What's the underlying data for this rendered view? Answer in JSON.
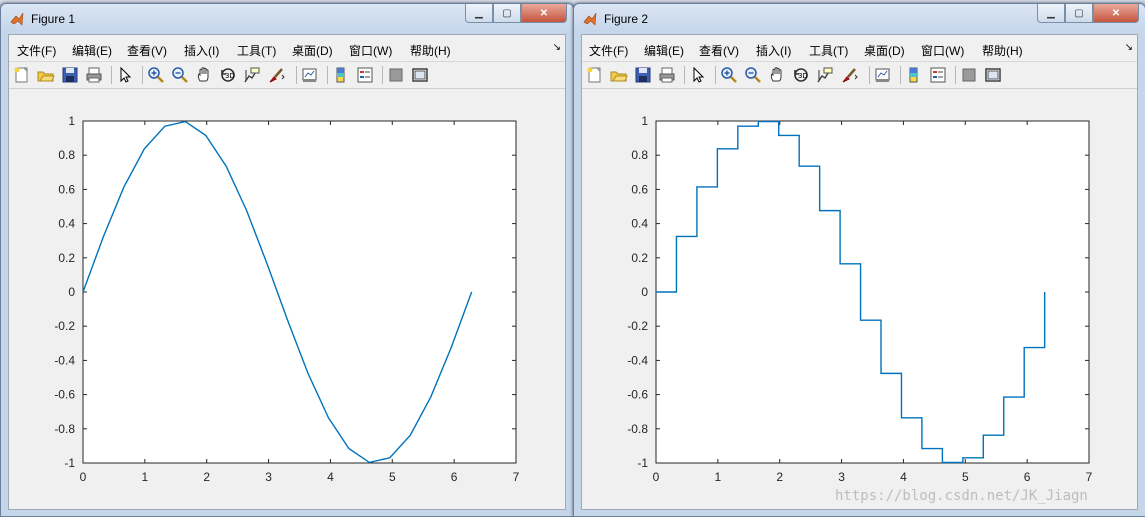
{
  "figures": [
    {
      "title": "Figure 1",
      "menu": [
        "文件(F)",
        "编辑(E)",
        "查看(V)",
        "插入(I)",
        "工具(T)",
        "桌面(D)",
        "窗口(W)",
        "帮助(H)"
      ],
      "chart_data": {
        "type": "line",
        "color": "#0072bd",
        "x": [
          0,
          0.3307,
          0.6614,
          0.9921,
          1.3228,
          1.6535,
          1.9842,
          2.3149,
          2.6456,
          2.9762,
          3.3069,
          3.6376,
          3.9683,
          4.299,
          4.6297,
          4.9604,
          5.2911,
          5.6218,
          5.9525,
          6.2832
        ],
        "y": [
          0,
          0.3247,
          0.6142,
          0.8372,
          0.9694,
          0.9966,
          0.9158,
          0.7357,
          0.4759,
          0.1646,
          -0.1646,
          -0.4759,
          -0.7357,
          -0.9158,
          -0.9966,
          -0.9694,
          -0.8372,
          -0.6142,
          -0.3247,
          0
        ],
        "xlim": [
          0,
          7
        ],
        "ylim": [
          -1,
          1
        ],
        "xticks": [
          "0",
          "1",
          "2",
          "3",
          "4",
          "5",
          "6",
          "7"
        ],
        "yticks": [
          "1",
          "0.8",
          "0.6",
          "0.4",
          "0.2",
          "0",
          "-0.2",
          "-0.4",
          "-0.6",
          "-0.8",
          "-1"
        ]
      }
    },
    {
      "title": "Figure 2",
      "menu": [
        "文件(F)",
        "编辑(E)",
        "查看(V)",
        "插入(I)",
        "工具(T)",
        "桌面(D)",
        "窗口(W)",
        "帮助(H)"
      ],
      "chart_data": {
        "type": "stairs",
        "color": "#0072bd",
        "x": [
          0,
          0.3307,
          0.6614,
          0.9921,
          1.3228,
          1.6535,
          1.9842,
          2.3149,
          2.6456,
          2.9762,
          3.3069,
          3.6376,
          3.9683,
          4.299,
          4.6297,
          4.9604,
          5.2911,
          5.6218,
          5.9525,
          6.2832
        ],
        "y": [
          0,
          0.3247,
          0.6142,
          0.8372,
          0.9694,
          0.9966,
          0.9158,
          0.7357,
          0.4759,
          0.1646,
          -0.1646,
          -0.4759,
          -0.7357,
          -0.9158,
          -0.9966,
          -0.9694,
          -0.8372,
          -0.6142,
          -0.3247,
          0
        ],
        "xlim": [
          0,
          7
        ],
        "ylim": [
          -1,
          1
        ],
        "xticks": [
          "0",
          "1",
          "2",
          "3",
          "4",
          "5",
          "6",
          "7"
        ],
        "yticks": [
          "1",
          "0.8",
          "0.6",
          "0.4",
          "0.2",
          "0",
          "-0.2",
          "-0.4",
          "-0.6",
          "-0.8",
          "-1"
        ]
      }
    }
  ],
  "toolbar_icons": [
    "new-figure-icon",
    "open-file-icon",
    "save-icon",
    "print-icon",
    "|",
    "pointer-icon",
    "|",
    "zoom-in-icon",
    "zoom-out-icon",
    "pan-icon",
    "rotate-3d-icon",
    "data-cursor-icon",
    "brush-icon",
    "|",
    "link-plot-icon",
    "|",
    "colorbar-icon",
    "legend-icon",
    "|",
    "hide-plot-tools-icon",
    "show-plot-tools-icon"
  ],
  "watermark": "https://blog.csdn.net/JK_Jiagn"
}
